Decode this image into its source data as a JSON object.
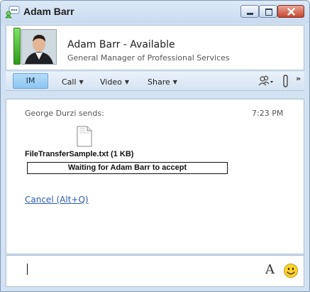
{
  "window": {
    "title": "Adam Barr"
  },
  "contact": {
    "name_status": "Adam Barr - Available",
    "job_title": "General Manager of Professional Services"
  },
  "toolbar": {
    "im_label": "IM",
    "call_label": "Call",
    "video_label": "Video",
    "share_label": "Share",
    "more_glyph": "»"
  },
  "conversation": {
    "sender_line": "George Durzi sends:",
    "time": "7:23 PM",
    "file_name": "FileTransferSample.txt (1 KB)",
    "transfer_status": "Waiting for Adam Barr to accept",
    "cancel_link": "Cancel (Alt+Q)"
  },
  "input": {
    "font_glyph": "A"
  },
  "icons": {
    "title": "communicator-icon",
    "presence": "presence-available-bar",
    "people": "people-icon",
    "attach": "paperclip-icon",
    "file": "text-file-icon",
    "emoticon": "smiley-icon"
  },
  "colors": {
    "available": "#3fb82a",
    "link": "#2a5db0",
    "im_tab": "#9fd0f4",
    "close_button": "#c9452f"
  }
}
